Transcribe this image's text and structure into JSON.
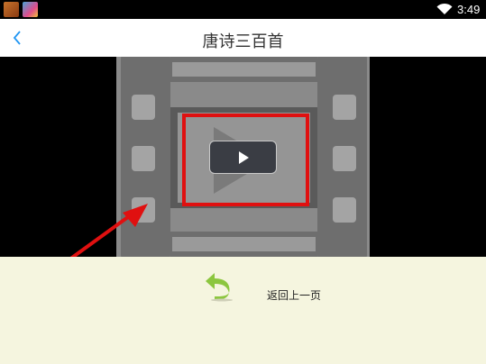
{
  "status_bar": {
    "time": "3:49",
    "icons": [
      "app-icon",
      "app-icon",
      "wifi-icon"
    ]
  },
  "header": {
    "back_icon": "chevron-left-icon",
    "title": "唐诗三百首"
  },
  "video": {
    "placeholder_icon": "film-icon",
    "play_icon": "play-icon"
  },
  "bottom": {
    "return_icon": "undo-arrow-icon",
    "return_label": "返回上一页"
  },
  "colors": {
    "accent": "#2196f3",
    "highlight": "#e01010",
    "panel_background": "#f5f5df",
    "return_icon": "#8cc63f"
  }
}
